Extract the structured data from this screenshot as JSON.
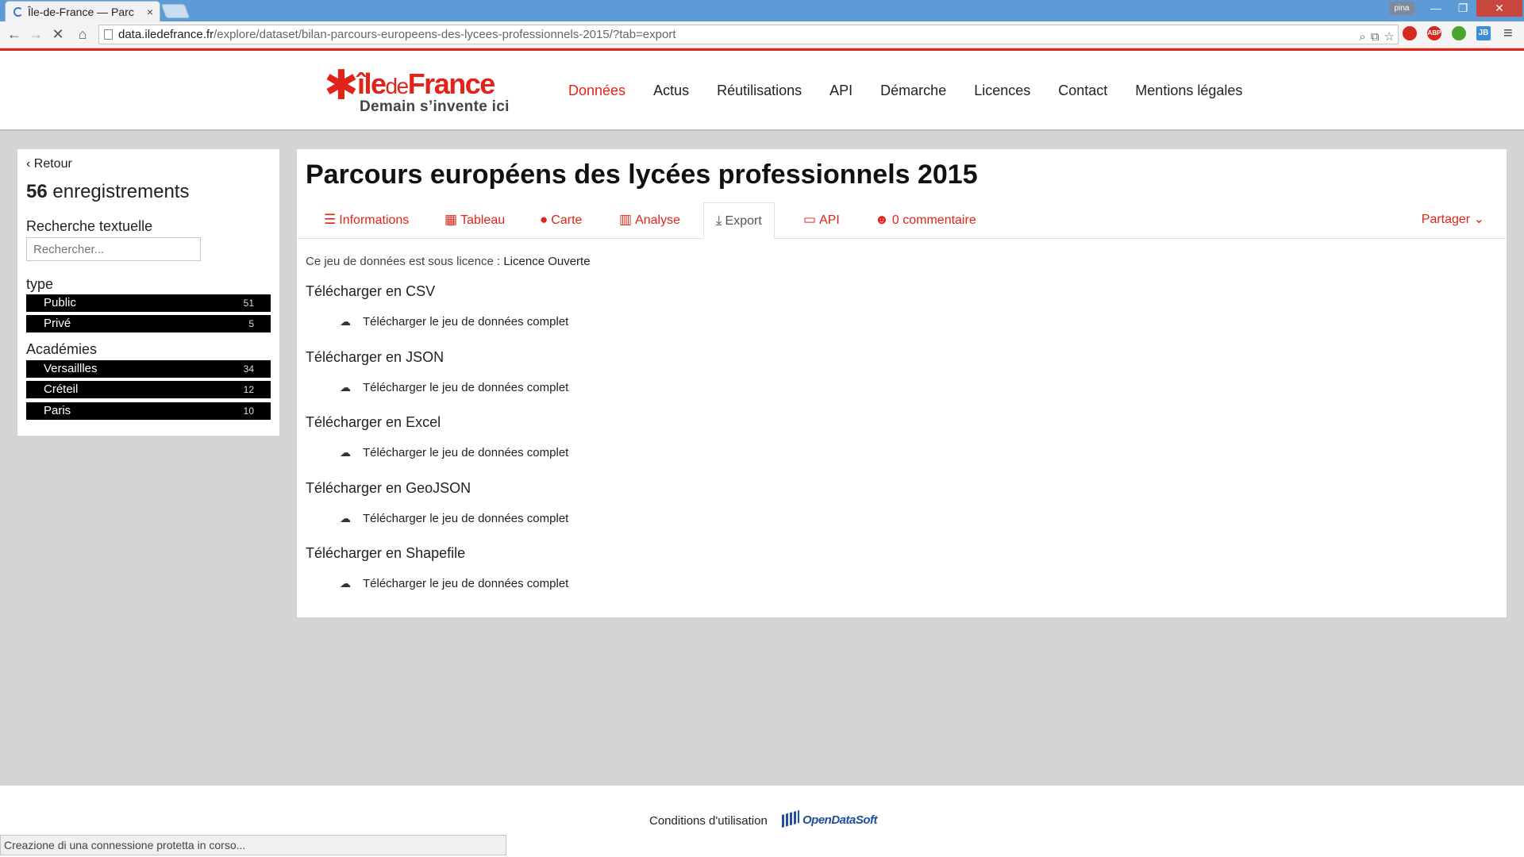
{
  "browser": {
    "tab_title": "Île-de-France — Parc",
    "tab_close": "×",
    "user_badge": "pina",
    "window_buttons": [
      "—",
      "❐",
      "✕"
    ],
    "url_host": "data.iledefrance.fr",
    "url_path": "/explore/dataset/bilan-parcours-europeens-des-lycees-professionnels-2015/?tab=export",
    "extensions": [
      {
        "name": "opera-icon",
        "label": "",
        "color": "#d6281f"
      },
      {
        "name": "adblock-icon",
        "label": "ABP",
        "color": "#d6281f"
      },
      {
        "name": "ghostery-icon",
        "label": "",
        "color": "#4aa52e"
      },
      {
        "name": "jetbrains-icon",
        "label": "JB",
        "color": "#3a8fd6"
      }
    ],
    "status_text": "Creazione di una connessione protetta in corso..."
  },
  "site": {
    "logo_brand_a": "île",
    "logo_brand_b": "de",
    "logo_brand_c": "France",
    "logo_tagline": "Demain s’invente ici",
    "nav": [
      "Données",
      "Actus",
      "Réutilisations",
      "API",
      "Démarche",
      "Licences",
      "Contact",
      "Mentions légales"
    ],
    "nav_active_index": 0,
    "brand_color": "#e2231a"
  },
  "sidebar": {
    "back_label": "Retour",
    "record_count": "56",
    "record_label": "enregistrements",
    "search_label": "Recherche textuelle",
    "search_placeholder": "Rechercher...",
    "facets": [
      {
        "title": "type",
        "items": [
          {
            "label": "Public",
            "count": "51"
          },
          {
            "label": "Privé",
            "count": "5"
          }
        ]
      },
      {
        "title": "Académies",
        "items": [
          {
            "label": "Versaillles",
            "count": "34"
          },
          {
            "label": "Créteil",
            "count": "12"
          },
          {
            "label": "Paris",
            "count": "10"
          }
        ]
      }
    ]
  },
  "main": {
    "title": "Parcours européens des lycées professionnels 2015",
    "tabs": [
      {
        "label": "Informations",
        "icon": "list-icon"
      },
      {
        "label": "Tableau",
        "icon": "table-icon"
      },
      {
        "label": "Carte",
        "icon": "globe-icon"
      },
      {
        "label": "Analyse",
        "icon": "bar-chart-icon"
      },
      {
        "label": "Export",
        "icon": "download-icon",
        "active": true
      },
      {
        "label": "API",
        "icon": "laptop-icon"
      },
      {
        "label": "0 commentaire",
        "icon": "users-icon"
      }
    ],
    "share_label": "Partager",
    "license_prefix": "Ce jeu de données est sous licence :",
    "license_name": "Licence Ouverte",
    "downloads": [
      {
        "title": "Télécharger en CSV",
        "link": "Télécharger le jeu de données complet"
      },
      {
        "title": "Télécharger en JSON",
        "link": "Télécharger le jeu de données complet"
      },
      {
        "title": "Télécharger en Excel",
        "link": "Télécharger le jeu de données complet"
      },
      {
        "title": "Télécharger en GeoJSON",
        "link": "Télécharger le jeu de données complet"
      },
      {
        "title": "Télécharger en Shapefile",
        "link": "Télécharger le jeu de données complet"
      }
    ]
  },
  "footer": {
    "terms": "Conditions d'utilisation",
    "powered_by": "OpenDataSoft"
  }
}
